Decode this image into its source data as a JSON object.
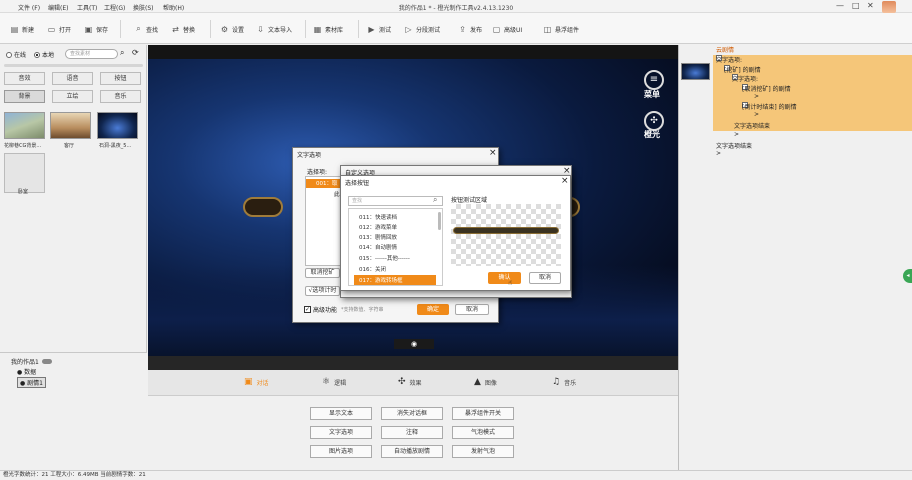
{
  "window": {
    "title": "我的作品1 * - 橙光制作工具v2.4.13.1230",
    "menus": [
      "文件 (F)",
      "编辑(E)",
      "工具(T)",
      "工程(G)",
      "换肤(S)",
      "帮助(H)"
    ]
  },
  "toolbar": {
    "items": [
      {
        "label": "新建",
        "icon": "new-file-icon"
      },
      {
        "label": "打开",
        "icon": "open-folder-icon"
      },
      {
        "label": "保存",
        "icon": "save-icon"
      },
      {
        "label": "查找",
        "icon": "search-icon"
      },
      {
        "label": "替换",
        "icon": "replace-icon"
      },
      {
        "label": "设置",
        "icon": "gear-icon"
      },
      {
        "label": "文本导入",
        "icon": "text-import-icon"
      },
      {
        "label": "素材库",
        "icon": "library-icon"
      },
      {
        "label": "测试",
        "icon": "play-icon"
      },
      {
        "label": "分段测试",
        "icon": "segment-test-icon"
      },
      {
        "label": "发布",
        "icon": "publish-icon"
      },
      {
        "label": "高级UI",
        "icon": "ui-icon"
      },
      {
        "label": "悬浮组件",
        "icon": "float-widget-icon"
      }
    ]
  },
  "left": {
    "radio_online": "在线",
    "radio_local": "本地",
    "search_placeholder": "查找素材",
    "categories": [
      "音效",
      "语音",
      "按钮",
      "背景",
      "立绘",
      "音乐"
    ],
    "thumbs": [
      "花柳巷CG背景...",
      "客厅",
      "石洞-黑夜_5...",
      "卧室"
    ],
    "project_title": "我的作品1",
    "tree": [
      "数据",
      "剧情1"
    ]
  },
  "stage": {
    "menu_label": "菜单",
    "logo_label": "橙光"
  },
  "bottom": {
    "tabs": [
      "对话",
      "逻辑",
      "效果",
      "图像",
      "音乐"
    ],
    "commands": [
      "显示文本",
      "消失对话框",
      "暴浮组件开关",
      "文字选项",
      "注释",
      "气泡模式",
      "图片选项",
      "自动播放剧情",
      "发射气泡"
    ]
  },
  "right": {
    "header": "云剧情",
    "lines": [
      "文字选项:",
      "[挖矿] 的剧情",
      "文字选项:",
      "[取消挖矿] 的剧情",
      ">",
      "[倒计时结束] 的剧情",
      ">",
      "文字选项结束",
      ">",
      "文字选项结束",
      ">"
    ]
  },
  "dialog_text_option": {
    "title": "文字选项",
    "label_options": "选择项:",
    "item_first": "001：取",
    "item_second": "此",
    "btn_cancel_dig": "取消挖矿",
    "btn_timer": "√选项计时",
    "advanced_label": "高级功能",
    "advanced_hint": "*支持数值、字符串",
    "ok": "确定",
    "cancel": "取消"
  },
  "dialog_custom": {
    "title": "自定义选项"
  },
  "dialog_button": {
    "title": "选择按钮",
    "search_placeholder": "查找",
    "items": [
      "011：快速读档",
      "012：游戏菜单",
      "013：剧情回放",
      "014：自动剧情",
      "015：------其他------",
      "016：关闭",
      "017：游戏转场框"
    ],
    "preview_label": "按钮测试区域",
    "ok": "确认",
    "cancel": "取消"
  },
  "status": {
    "text": "橙光字数统计：21  工程大小：6.49MB  当前剧情字数：21"
  },
  "colors": {
    "accent": "#f08a19",
    "highlight_row": "#f5c679"
  }
}
